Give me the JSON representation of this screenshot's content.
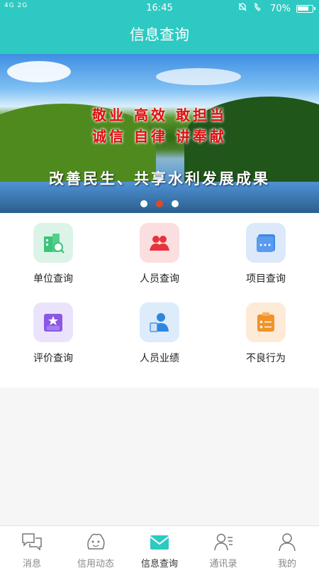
{
  "status_bar": {
    "signal": "4G 2G",
    "time": "16:45",
    "battery": "70%"
  },
  "header": {
    "title": "信息查询"
  },
  "banner": {
    "slogan_line1": "敬业 高效 敢担当",
    "slogan_line2": "诚信 自律 讲奉献",
    "caption": "改善民生、共享水利发展成果",
    "active_dot": 1
  },
  "grid": [
    {
      "label": "单位查询",
      "icon": "building-search-icon",
      "bg": "#dcf4e8",
      "fg": "#3cc57a"
    },
    {
      "label": "人员查询",
      "icon": "people-icon",
      "bg": "#fbdedf",
      "fg": "#e8323c"
    },
    {
      "label": "项目查询",
      "icon": "project-icon",
      "bg": "#dbe9fa",
      "fg": "#3f86e6"
    },
    {
      "label": "评价查询",
      "icon": "evaluation-icon",
      "bg": "#ebe3fb",
      "fg": "#8b58e6"
    },
    {
      "label": "人员业绩",
      "icon": "person-achievement-icon",
      "bg": "#dcecfb",
      "fg": "#2f86e0"
    },
    {
      "label": "不良行为",
      "icon": "bad-behavior-icon",
      "bg": "#fdebd8",
      "fg": "#f39226"
    }
  ],
  "tabbar": {
    "active": "信息查询",
    "items": [
      {
        "label": "消息",
        "icon": "chat-icon"
      },
      {
        "label": "信用动态",
        "icon": "credit-news-icon"
      },
      {
        "label": "信息查询",
        "icon": "mail-icon"
      },
      {
        "label": "通讯录",
        "icon": "contacts-icon"
      },
      {
        "label": "我的",
        "icon": "profile-icon"
      }
    ]
  }
}
